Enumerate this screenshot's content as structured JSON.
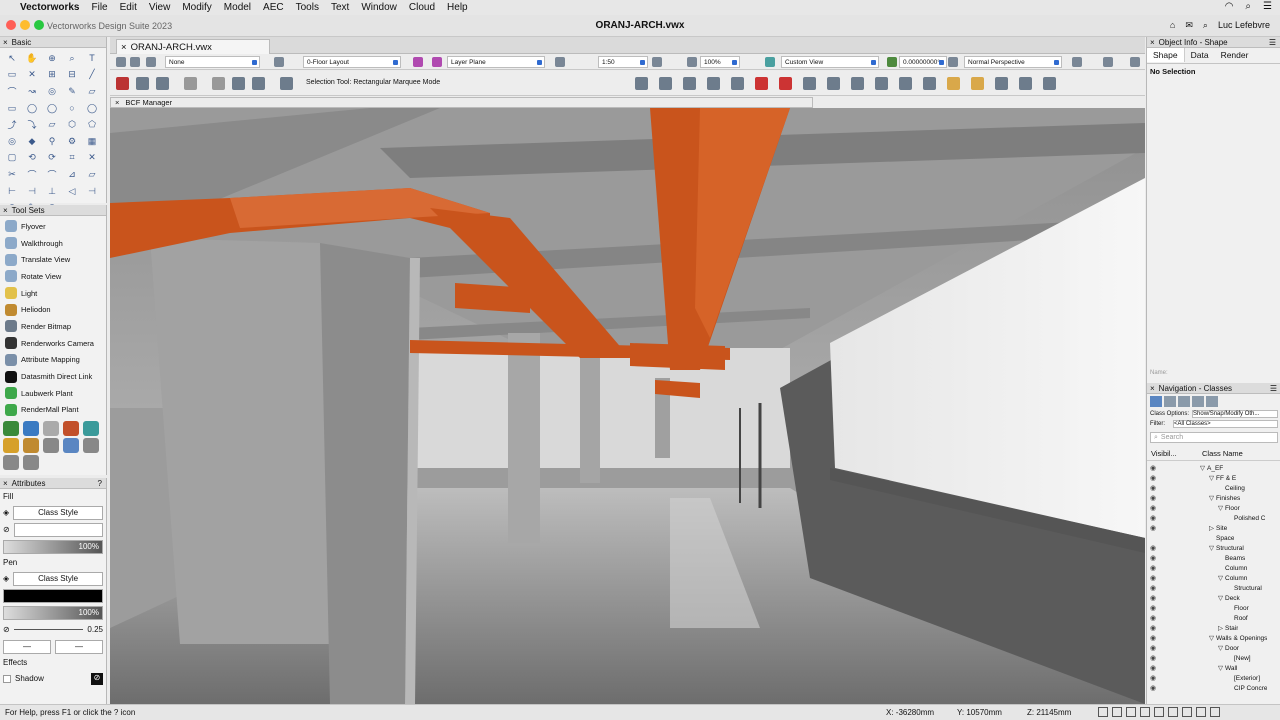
{
  "menubar": {
    "app": "Vectorworks",
    "items": [
      "File",
      "Edit",
      "View",
      "Modify",
      "Model",
      "AEC",
      "Tools",
      "Text",
      "Window",
      "Cloud",
      "Help"
    ]
  },
  "window": {
    "suite": "Vectorworks Design Suite 2023",
    "title": "ORANJ-ARCH.vwx",
    "user": "Luc Lefebvre"
  },
  "basic_palette": {
    "title": "Basic"
  },
  "tool_sets": {
    "title": "Tool Sets",
    "items": [
      "Flyover",
      "Walkthrough",
      "Translate View",
      "Rotate View",
      "Light",
      "Heliodon",
      "Render Bitmap",
      "Renderworks Camera",
      "Attribute Mapping",
      "Datasmith Direct Link",
      "Laubwerk Plant",
      "RenderMall Plant"
    ]
  },
  "attributes": {
    "title": "Attributes",
    "fill_label": "Fill",
    "fill_style": "Class Style",
    "fill_opacity": "100%",
    "pen_label": "Pen",
    "pen_style": "Class Style",
    "pen_opacity": "100%",
    "line_weight": "0.25",
    "effects_label": "Effects",
    "shadow_label": "Shadow"
  },
  "document_tab": {
    "label": "ORANJ-ARCH.vwx"
  },
  "view_bar": {
    "saved_view": "None",
    "layer": "0-Floor Layout",
    "plane": "Layer Plane",
    "scale": "1:50",
    "zoom": "100%",
    "view": "Custom View",
    "rotation": "0.00000000°",
    "projection": "Normal Perspective"
  },
  "mode_bar": {
    "text": "Selection Tool: Rectangular Marquee Mode"
  },
  "bcf": {
    "label": "BCF Manager"
  },
  "object_info": {
    "title": "Object Info - Shape",
    "tabs": [
      "Shape",
      "Data",
      "Render"
    ],
    "selection": "No Selection",
    "name_label": "Name:"
  },
  "navigation": {
    "title": "Navigation - Classes",
    "class_options_label": "Class Options:",
    "class_options_value": "Show/Snap/Modify Oth...",
    "filter_label": "Filter:",
    "filter_value": "<All Classes>",
    "search_placeholder": "Search",
    "col_visibility": "Visibil...",
    "col_name": "Class Name",
    "rows": [
      {
        "name": "A_EF",
        "indent": 0,
        "arrow": "▽"
      },
      {
        "name": "FF & E",
        "indent": 1,
        "arrow": "▽"
      },
      {
        "name": "Ceiling",
        "indent": 2,
        "arrow": ""
      },
      {
        "name": "Finishes",
        "indent": 1,
        "arrow": "▽"
      },
      {
        "name": "Floor",
        "indent": 2,
        "arrow": "▽"
      },
      {
        "name": "Polished C",
        "indent": 3,
        "arrow": ""
      },
      {
        "name": "Site",
        "indent": 1,
        "arrow": "▷"
      },
      {
        "name": "Space",
        "indent": 1,
        "arrow": ""
      },
      {
        "name": "Structural",
        "indent": 1,
        "arrow": "▽"
      },
      {
        "name": "Beams",
        "indent": 2,
        "arrow": ""
      },
      {
        "name": "Column",
        "indent": 2,
        "arrow": ""
      },
      {
        "name": "Column",
        "indent": 2,
        "arrow": "▽"
      },
      {
        "name": "Structural",
        "indent": 3,
        "arrow": ""
      },
      {
        "name": "Deck",
        "indent": 2,
        "arrow": "▽"
      },
      {
        "name": "Floor",
        "indent": 3,
        "arrow": ""
      },
      {
        "name": "Roof",
        "indent": 3,
        "arrow": ""
      },
      {
        "name": "Stair",
        "indent": 2,
        "arrow": "▷"
      },
      {
        "name": "Walls & Openings",
        "indent": 1,
        "arrow": "▽"
      },
      {
        "name": "Door",
        "indent": 2,
        "arrow": "▽"
      },
      {
        "name": "[New]",
        "indent": 3,
        "arrow": ""
      },
      {
        "name": "Wall",
        "indent": 2,
        "arrow": "▽"
      },
      {
        "name": "[Exterior]",
        "indent": 3,
        "arrow": ""
      },
      {
        "name": "CIP Concre",
        "indent": 3,
        "arrow": ""
      }
    ]
  },
  "status": {
    "help": "For Help, press F1 or click the ? icon",
    "x": "X: -36280mm",
    "y": "Y: 10570mm",
    "z": "Z: 21145mm"
  },
  "colors": {
    "duct": "#c9541c",
    "accent": "#2f6ad0"
  }
}
